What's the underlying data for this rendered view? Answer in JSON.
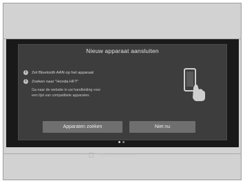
{
  "dialog": {
    "title": "Nieuw apparaat aansluiten",
    "steps": [
      {
        "icon": "info-icon",
        "text": "Zet Bluetooth AAN op het apparaat"
      },
      {
        "icon": "info-icon",
        "text": "Zoeken naar \"Honda HFT\""
      }
    ],
    "hint_line1": "Ga naar de website in uw handleiding voor",
    "hint_line2": "een lijst van compatibele apparaten.",
    "checkbox_label": "Niet opnieuw weergeven",
    "checkbox_checked": false,
    "buttons": {
      "search": "Apparaten zoeken",
      "not_now": "Niet nu"
    }
  },
  "pager": {
    "current": 1,
    "total": 2
  }
}
